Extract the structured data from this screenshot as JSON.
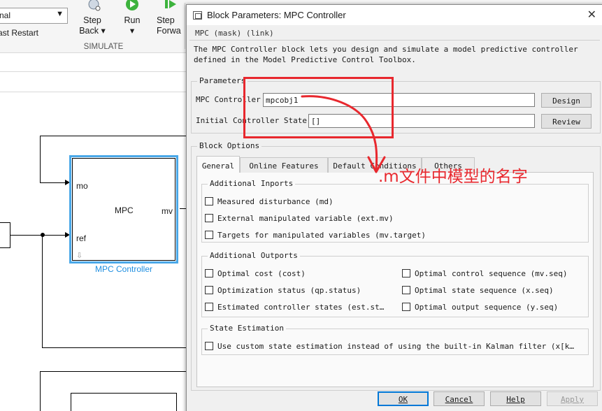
{
  "toolstrip": {
    "mode_value": "nal",
    "fast_restart": "ast Restart",
    "step_back_l1": "Step",
    "step_back_l2": "Back ▾",
    "run_l1": "Run",
    "run_l2": "▾",
    "step_fwd_l1": "Step",
    "step_fwd_l2": "Forwa",
    "group_label": "SIMULATE"
  },
  "model": {
    "block_title": "MPC",
    "port_mo": "mo",
    "port_ref": "ref",
    "port_mv": "mv",
    "block_name": "MPC Controller"
  },
  "dialog": {
    "title": "Block Parameters: MPC Controller",
    "mask_line": "MPC (mask) (link)",
    "description": "The MPC Controller block lets you design and simulate a model predictive controller defined in the Model Predictive Control Toolbox.",
    "parameters": {
      "title": "Parameters",
      "controller_label": "MPC Controller",
      "controller_value": "mpcobj1",
      "design_label": "Design",
      "state_label": "Initial Controller State",
      "state_value": "[]",
      "review_label": "Review"
    },
    "block_options": {
      "title": "Block Options",
      "tabs": [
        "General",
        "Online Features",
        "Default Conditions",
        "Others"
      ],
      "active_tab": "General",
      "inports": {
        "title": "Additional Inports",
        "items": [
          "Measured disturbance (md)",
          "External manipulated variable (ext.mv)",
          "Targets for manipulated variables (mv.target)"
        ]
      },
      "outports": {
        "title": "Additional Outports",
        "left": [
          "Optimal cost (cost)",
          "Optimization status (qp.status)",
          "Estimated controller states (est.st…"
        ],
        "right": [
          "Optimal control sequence (mv.seq)",
          "Optimal state sequence (x.seq)",
          "Optimal output sequence (y.seq)"
        ]
      },
      "estimation": {
        "title": "State Estimation",
        "item": "Use custom state estimation instead of using the built-in Kalman filter (x[k…"
      }
    },
    "buttons": {
      "ok": "OK",
      "cancel": "Cancel",
      "help": "Help",
      "apply": "Apply"
    }
  },
  "annotation": {
    "text": ".m文件中模型的名字",
    "color": "#e8282e"
  }
}
